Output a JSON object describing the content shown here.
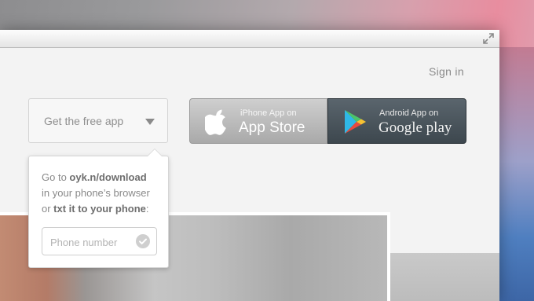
{
  "header": {
    "sign_in": "Sign in"
  },
  "app_select": {
    "label": "Get the free app"
  },
  "popover": {
    "line1_prefix": "Go to ",
    "url": "oyk.n/download",
    "line2": "in your phone’s browser",
    "line3_prefix": "or ",
    "txt_label": "txt it to your phone",
    "line3_suffix": ":",
    "phone_placeholder": "Phone number"
  },
  "store_buttons": {
    "ios": {
      "small": "iPhone App on",
      "big": "App Store",
      "icon": "apple-icon"
    },
    "android": {
      "small": "Android App on",
      "big": "Google play",
      "icon": "google-play-icon"
    }
  }
}
